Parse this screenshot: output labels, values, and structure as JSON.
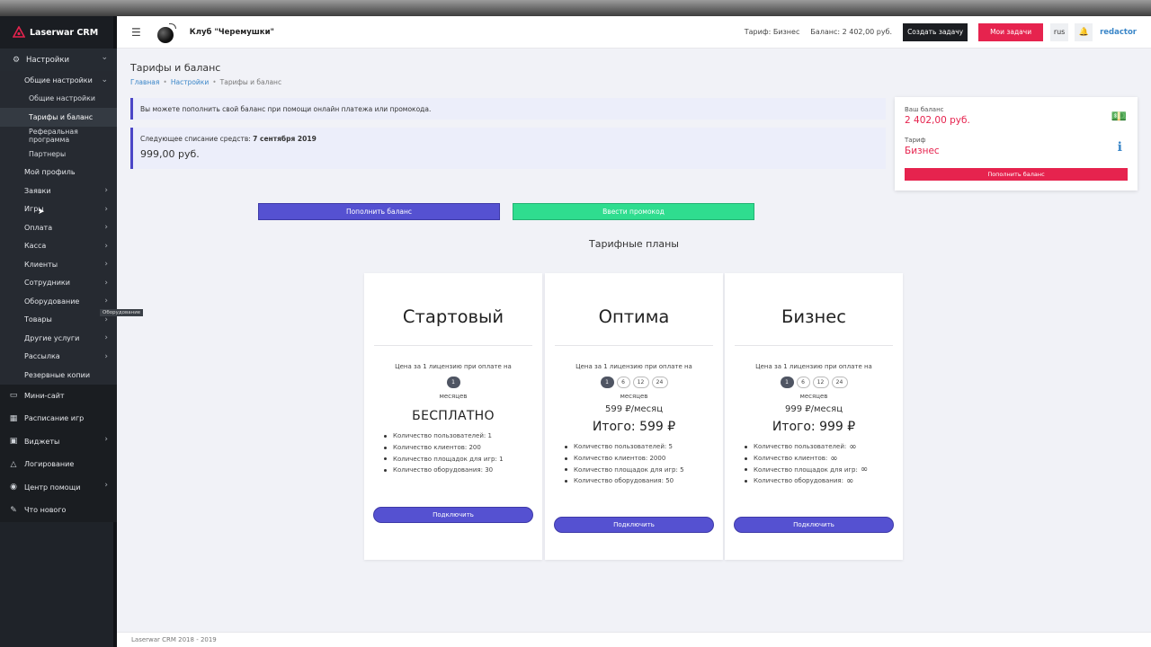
{
  "app": {
    "brand": "Laserwar CRM",
    "club_name": "Клуб \"Черемушки\""
  },
  "sidebar": {
    "settings_label": "Настройки",
    "general_settings_label": "Общие настройки",
    "leaves": [
      "Общие настройки",
      "Тарифы и баланс",
      "Реферальная программа",
      "Партнеры"
    ],
    "items": [
      "Мой профиль",
      "Заявки",
      "Игры",
      "Оплата",
      "Касса",
      "Клиенты",
      "Сотрудники",
      "Оборудование",
      "Товары",
      "Другие услуги",
      "Рассылка",
      "Резервные копии"
    ],
    "main": [
      "Мини-сайт",
      "Расписание игр",
      "Виджеты",
      "Логирование",
      "Центр помощи",
      "Что нового"
    ],
    "tooltip": "Оборудование"
  },
  "header": {
    "tariff": "Тариф: Бизнес",
    "balance": "Баланс: 2 402,00 руб.",
    "create_task": "Создать задачу",
    "my_tasks": "Мои задачи",
    "lang": "rus",
    "user": "redactor"
  },
  "page": {
    "title": "Тарифы и баланс",
    "breadcrumb": [
      "Главная",
      "Настройки",
      "Тарифы и баланс"
    ],
    "alert_topup": "Вы можете пополнить свой баланс при помощи онлайн платежа или промокода.",
    "next_charge_label": "Следующее списание средств: ",
    "next_charge_date": "7 сентября 2019",
    "next_charge_amount": "999,00 руб.",
    "topup_button": "Пополнить баланс",
    "promo_button": "Ввести промокод",
    "plans_title": "Тарифные планы"
  },
  "balance_box": {
    "balance_label": "Ваш баланс",
    "balance_value": "2 402,00 руб.",
    "tariff_label": "Тариф",
    "tariff_value": "Бизнес",
    "button": "Пополнить баланс"
  },
  "plans": [
    {
      "name": "Стартовый",
      "price_label": "Цена за 1 лицензию при оплате на",
      "periods": [
        "1"
      ],
      "months": "месяцев",
      "price_main": "БЕСПЛАТНО",
      "features": [
        "Количество пользователей: 1",
        "Количество клиентов: 200",
        "Количество площадок для игр: 1",
        "Количество оборудования: 30"
      ],
      "button": "Подключить"
    },
    {
      "name": "Оптима",
      "price_label": "Цена за 1 лицензию при оплате на",
      "periods": [
        "1",
        "6",
        "12",
        "24"
      ],
      "months": "месяцев",
      "monthly": "599 ₽/месяц",
      "total": "Итого: 599 ₽",
      "features": [
        "Количество пользователей: 5",
        "Количество клиентов: 2000",
        "Количество площадок для игр: 5",
        "Количество оборудования: 50"
      ],
      "button": "Подключить"
    },
    {
      "name": "Бизнес",
      "price_label": "Цена за 1 лицензию при оплате на",
      "periods": [
        "1",
        "6",
        "12",
        "24"
      ],
      "months": "месяцев",
      "monthly": "999 ₽/месяц",
      "total": "Итого: 999 ₽",
      "features": [
        "Количество пользователей:",
        "Количество клиентов:",
        "Количество площадок для игр:",
        "Количество оборудования:"
      ],
      "infinity": "∞",
      "button": "Подключить"
    }
  ],
  "footer": {
    "copyright": "Laserwar CRM 2018 - 2019"
  },
  "colors": {
    "accent": "#5551d1",
    "danger": "#e6234e",
    "success": "#2fdd8f",
    "sidebar": "#1f2329"
  }
}
